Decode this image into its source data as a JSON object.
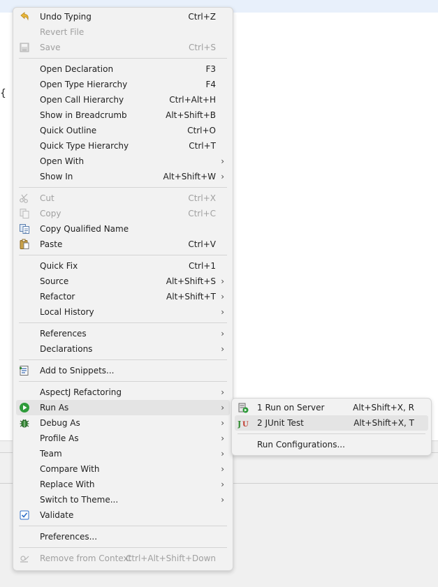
{
  "editor": {
    "brace": "{"
  },
  "menu": {
    "items": [
      {
        "label": "Undo Typing",
        "shortcut": "Ctrl+Z"
      },
      {
        "label": "Revert File",
        "shortcut": ""
      },
      {
        "label": "Save",
        "shortcut": "Ctrl+S"
      },
      {
        "label": "Open Declaration",
        "shortcut": "F3"
      },
      {
        "label": "Open Type Hierarchy",
        "shortcut": "F4"
      },
      {
        "label": "Open Call Hierarchy",
        "shortcut": "Ctrl+Alt+H"
      },
      {
        "label": "Show in Breadcrumb",
        "shortcut": "Alt+Shift+B"
      },
      {
        "label": "Quick Outline",
        "shortcut": "Ctrl+O"
      },
      {
        "label": "Quick Type Hierarchy",
        "shortcut": "Ctrl+T"
      },
      {
        "label": "Open With",
        "shortcut": ""
      },
      {
        "label": "Show In",
        "shortcut": "Alt+Shift+W"
      },
      {
        "label": "Cut",
        "shortcut": "Ctrl+X"
      },
      {
        "label": "Copy",
        "shortcut": "Ctrl+C"
      },
      {
        "label": "Copy Qualified Name",
        "shortcut": ""
      },
      {
        "label": "Paste",
        "shortcut": "Ctrl+V"
      },
      {
        "label": "Quick Fix",
        "shortcut": "Ctrl+1"
      },
      {
        "label": "Source",
        "shortcut": "Alt+Shift+S"
      },
      {
        "label": "Refactor",
        "shortcut": "Alt+Shift+T"
      },
      {
        "label": "Local History",
        "shortcut": ""
      },
      {
        "label": "References",
        "shortcut": ""
      },
      {
        "label": "Declarations",
        "shortcut": ""
      },
      {
        "label": "Add to Snippets...",
        "shortcut": ""
      },
      {
        "label": "AspectJ Refactoring",
        "shortcut": ""
      },
      {
        "label": "Run As",
        "shortcut": ""
      },
      {
        "label": "Debug As",
        "shortcut": ""
      },
      {
        "label": "Profile As",
        "shortcut": ""
      },
      {
        "label": "Team",
        "shortcut": ""
      },
      {
        "label": "Compare With",
        "shortcut": ""
      },
      {
        "label": "Replace With",
        "shortcut": ""
      },
      {
        "label": "Switch to Theme...",
        "shortcut": ""
      },
      {
        "label": "Validate",
        "shortcut": ""
      },
      {
        "label": "Preferences...",
        "shortcut": ""
      },
      {
        "label": "Remove from Context",
        "shortcut": "Ctrl+Alt+Shift+Down"
      }
    ],
    "submenu_arrow": "›"
  },
  "run_as_submenu": {
    "items": [
      {
        "label": "1 Run on Server",
        "shortcut": "Alt+Shift+X, R"
      },
      {
        "label": "2 JUnit Test",
        "shortcut": "Alt+Shift+X, T"
      },
      {
        "label": "Run Configurations...",
        "shortcut": ""
      }
    ]
  },
  "colors": {
    "menu_bg": "#f2f2f2",
    "hover_bg": "#e4e4e4",
    "disabled_text": "#a0a0a0",
    "run_green": "#2e9b3a",
    "debug_green": "#3a8a3a",
    "checkbox_blue": "#2f6fc8"
  }
}
